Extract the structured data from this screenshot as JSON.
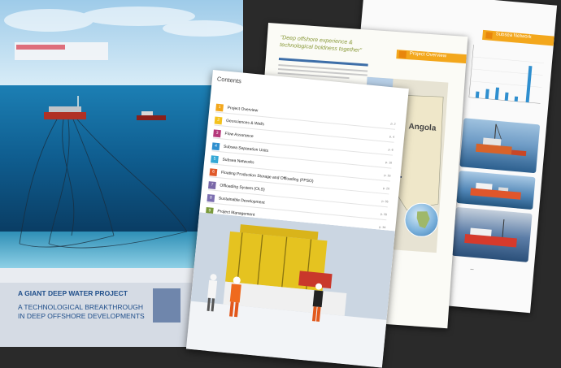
{
  "cover": {
    "title": "A GIANT DEEP WATER PROJECT",
    "subtitle_line1": "A TECHNOLOGICAL BREAKTHROUGH",
    "subtitle_line2": "IN DEEP OFFSHORE DEVELOPMENTS"
  },
  "contents": {
    "heading": "Contents",
    "items": [
      {
        "num": "1",
        "label": "Project Overview",
        "page": "p. 2",
        "color": "#f3a71c"
      },
      {
        "num": "2",
        "label": "Geosciences & Wells",
        "page": "p. 4",
        "color": "#f4c21e"
      },
      {
        "num": "3",
        "label": "Flow Assurance",
        "page": "p. 6",
        "color": "#b5387a"
      },
      {
        "num": "4",
        "label": "Subsea Separation Units",
        "page": "p. 10",
        "color": "#2f8fcf"
      },
      {
        "num": "5",
        "label": "Subsea Networks",
        "page": "p. 16",
        "color": "#35a8d6"
      },
      {
        "num": "6",
        "label": "Floating Production Storage and Offloading (FPSO)",
        "page": "p. 20",
        "color": "#e0592a"
      },
      {
        "num": "7",
        "label": "Offloading System (OLS)",
        "page": "p. 26",
        "color": "#7a68a8"
      },
      {
        "num": "8",
        "label": "Sustainable Development",
        "page": "p. 28",
        "color": "#7c6fb0"
      },
      {
        "num": "9",
        "label": "Project Management",
        "page": "p. 34",
        "color": "#7a9a3a"
      }
    ]
  },
  "overview_page": {
    "quote": "\"Deep offshore experience & technological boldness together\"",
    "section_label": "Project Overview",
    "section_num": "1",
    "map_label": "Angola"
  },
  "network_page": {
    "section_label": "Subsea Network",
    "section_num": "5"
  },
  "colors": {
    "accent": "#f3a71c",
    "cover_text": "#1f4e8a"
  }
}
